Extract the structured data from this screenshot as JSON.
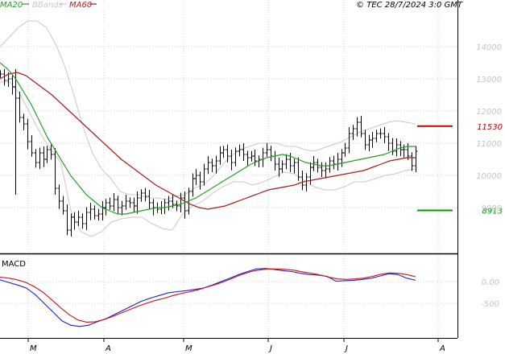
{
  "header": {
    "legend": [
      {
        "label": "MA20",
        "color": "#22a022"
      },
      {
        "label": "BBands",
        "color": "#c8c8c8"
      },
      {
        "label": "MA60",
        "color": "#aa1c1c"
      }
    ],
    "copyright": "© TEC 28/7/2024 3:0 GMT"
  },
  "chart_data": [
    {
      "type": "line",
      "title": "",
      "y_ticks": [
        "14000",
        "13000",
        "12000",
        "11000",
        "10000",
        "9000"
      ],
      "ylim": [
        8000,
        15000
      ],
      "x_ticks": [
        "M",
        "A",
        "M",
        "J",
        "J",
        "A"
      ],
      "grid": true,
      "legend_position": "top-left",
      "series": [
        {
          "name": "MA20",
          "color": "#22a022",
          "values": [
            13500,
            13300,
            13000,
            12600,
            12200,
            11700,
            11200,
            10800,
            10400,
            10000,
            9700,
            9400,
            9200,
            9000,
            8900,
            8800,
            8800,
            8850,
            8900,
            8950,
            9000,
            9000,
            9050,
            9100,
            9200,
            9300,
            9450,
            9600,
            9750,
            9900,
            10050,
            10200,
            10350,
            10450,
            10550,
            10600,
            10650,
            10600,
            10500,
            10400,
            10350,
            10300,
            10300,
            10350,
            10400,
            10450,
            10500,
            10550,
            10600,
            10650,
            10750,
            10850,
            10900,
            10900
          ]
        },
        {
          "name": "MA60",
          "color": "#aa1c1c",
          "values": [
            13000,
            13150,
            13200,
            13100,
            12900,
            12700,
            12500,
            12250,
            12000,
            11750,
            11500,
            11250,
            11000,
            10750,
            10500,
            10300,
            10100,
            9900,
            9700,
            9550,
            9400,
            9250,
            9100,
            9000,
            8950,
            9000,
            9050,
            9150,
            9250,
            9350,
            9450,
            9550,
            9600,
            9650,
            9700,
            9800,
            9850,
            9900,
            9950,
            10000,
            10050,
            10100,
            10150,
            10250,
            10350,
            10450,
            10500,
            10550,
            10550
          ]
        },
        {
          "name": "BBands",
          "color": "#c8c8c8",
          "upper": [
            14000,
            14300,
            14600,
            14800,
            14800,
            14600,
            14100,
            13400,
            12500,
            11500,
            10700,
            10200,
            9900,
            9500,
            9400,
            9400,
            9300,
            9300,
            9250,
            9350,
            9400,
            9600,
            9700,
            9950,
            10300,
            10600,
            10800,
            10900,
            11000,
            11000,
            11000,
            10900,
            10900,
            10800,
            10750,
            10850,
            10950,
            11050,
            11200,
            11350,
            11450,
            11550,
            11650,
            11700,
            11650,
            11600
          ],
          "lower": [
            12900,
            12900,
            12500,
            11900,
            11300,
            10800,
            10400,
            8900,
            8250,
            8100,
            8250,
            8550,
            8650,
            8700,
            8700,
            8500,
            8350,
            8300,
            8800,
            9050,
            9200,
            9450,
            9650,
            9800,
            9800,
            9700,
            9800,
            9950,
            10100,
            10050,
            9850,
            9650,
            9550,
            9550,
            9650,
            9800,
            9800,
            9900,
            10000,
            10050,
            10150,
            10200
          ]
        }
      ],
      "levels": [
        {
          "value": 11530,
          "label": "11530",
          "color": "#cc0000"
        },
        {
          "value": 8913,
          "label": "8913",
          "color": "#009900"
        }
      ],
      "ohlc_closes": [
        13150,
        12950,
        13000,
        12750,
        12400,
        11800,
        11600,
        11050,
        10700,
        10400,
        10700,
        10500,
        10800,
        10650,
        9600,
        9200,
        8900,
        8300,
        8700,
        8550,
        8700,
        8500,
        8850,
        8950,
        8750,
        8800,
        9000,
        9150,
        9050,
        9250,
        9000,
        9050,
        9200,
        9150,
        9050,
        9300,
        9450,
        9350,
        9150,
        9000,
        8950,
        9000,
        9150,
        9200,
        9100,
        9050,
        9300,
        8900,
        9500,
        9900,
        10000,
        9800,
        10200,
        10400,
        10300,
        10450,
        10700,
        10800,
        10600,
        10400,
        10750,
        10800,
        10650,
        10550,
        10600,
        10450,
        10500,
        10700,
        10800,
        10600,
        10350,
        10200,
        10350,
        10500,
        10300,
        10400,
        9950,
        9700,
        9950,
        10250,
        10400,
        10250,
        10150,
        10200,
        10450,
        10350,
        10500,
        10700,
        10850,
        11300,
        11450,
        11650,
        11300,
        10950,
        11100,
        11150,
        11300,
        11300,
        11200,
        11000,
        10750,
        10950,
        10800,
        10800,
        10600,
        10300,
        10750
      ]
    },
    {
      "type": "line",
      "title": "MACD",
      "y_ticks": [
        "0.00",
        "-500"
      ],
      "ylim": [
        -1200,
        600
      ],
      "series": [
        {
          "name": "MACD",
          "color": "#1f1fd6",
          "values": [
            40,
            -20,
            -80,
            -150,
            -300,
            -500,
            -700,
            -900,
            -1000,
            -1030,
            -1000,
            -920,
            -850,
            -750,
            -650,
            -550,
            -450,
            -380,
            -320,
            -260,
            -230,
            -210,
            -180,
            -150,
            -80,
            0,
            80,
            160,
            230,
            290,
            300,
            280,
            250,
            230,
            190,
            160,
            150,
            120,
            10,
            20,
            30,
            50,
            80,
            130,
            180,
            160,
            80,
            30
          ]
        },
        {
          "name": "Signal",
          "color": "#cc1111",
          "values": [
            100,
            80,
            40,
            -20,
            -120,
            -250,
            -420,
            -600,
            -760,
            -880,
            -930,
            -920,
            -870,
            -800,
            -720,
            -640,
            -560,
            -490,
            -430,
            -380,
            -320,
            -270,
            -230,
            -180,
            -120,
            -60,
            10,
            90,
            170,
            230,
            270,
            290,
            290,
            280,
            260,
            220,
            190,
            150,
            100,
            60,
            50,
            60,
            80,
            120,
            170,
            200,
            190,
            160,
            110
          ]
        }
      ]
    }
  ]
}
